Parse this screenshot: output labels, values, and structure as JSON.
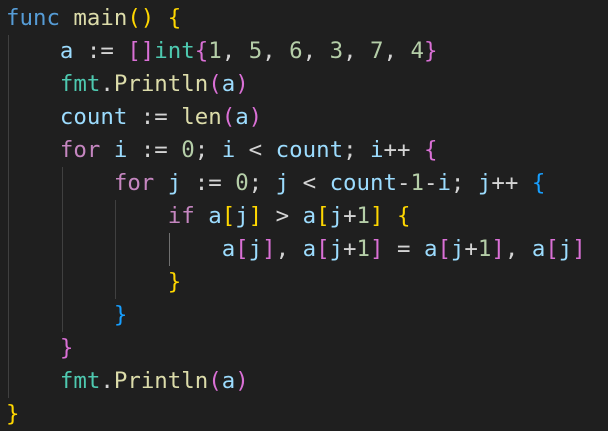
{
  "colors": {
    "background": "#1f1f1f",
    "default_text": "#d4d4d4",
    "keyword": "#569cd6",
    "control_keyword": "#c586c0",
    "function": "#dcdcaa",
    "variable": "#9cdcfe",
    "type": "#4ec9b0",
    "number": "#b5cea8",
    "bracket_level_1": "#ffd700",
    "bracket_level_2": "#da70d6",
    "bracket_level_3": "#179fff",
    "indent_guide": "#404040",
    "indent_guide_active": "#707070"
  },
  "code_lines": [
    [
      {
        "text": "func",
        "color": "#569cd6"
      },
      {
        "text": " ",
        "color": "#d4d4d4"
      },
      {
        "text": "main",
        "color": "#dcdcaa"
      },
      {
        "text": "()",
        "color": "#ffd700"
      },
      {
        "text": " ",
        "color": "#d4d4d4"
      },
      {
        "text": "{",
        "color": "#ffd700"
      }
    ],
    [
      {
        "text": "    ",
        "color": "#d4d4d4"
      },
      {
        "text": "a",
        "color": "#9cdcfe"
      },
      {
        "text": " := ",
        "color": "#d4d4d4"
      },
      {
        "text": "[]",
        "color": "#da70d6"
      },
      {
        "text": "int",
        "color": "#4ec9b0"
      },
      {
        "text": "{",
        "color": "#da70d6"
      },
      {
        "text": "1",
        "color": "#b5cea8"
      },
      {
        "text": ", ",
        "color": "#d4d4d4"
      },
      {
        "text": "5",
        "color": "#b5cea8"
      },
      {
        "text": ", ",
        "color": "#d4d4d4"
      },
      {
        "text": "6",
        "color": "#b5cea8"
      },
      {
        "text": ", ",
        "color": "#d4d4d4"
      },
      {
        "text": "3",
        "color": "#b5cea8"
      },
      {
        "text": ", ",
        "color": "#d4d4d4"
      },
      {
        "text": "7",
        "color": "#b5cea8"
      },
      {
        "text": ", ",
        "color": "#d4d4d4"
      },
      {
        "text": "4",
        "color": "#b5cea8"
      },
      {
        "text": "}",
        "color": "#da70d6"
      }
    ],
    [
      {
        "text": "    ",
        "color": "#d4d4d4"
      },
      {
        "text": "fmt",
        "color": "#4ec9b0"
      },
      {
        "text": ".",
        "color": "#d4d4d4"
      },
      {
        "text": "Println",
        "color": "#dcdcaa"
      },
      {
        "text": "(",
        "color": "#da70d6"
      },
      {
        "text": "a",
        "color": "#9cdcfe"
      },
      {
        "text": ")",
        "color": "#da70d6"
      }
    ],
    [
      {
        "text": "    ",
        "color": "#d4d4d4"
      },
      {
        "text": "count",
        "color": "#9cdcfe"
      },
      {
        "text": " := ",
        "color": "#d4d4d4"
      },
      {
        "text": "len",
        "color": "#dcdcaa"
      },
      {
        "text": "(",
        "color": "#da70d6"
      },
      {
        "text": "a",
        "color": "#9cdcfe"
      },
      {
        "text": ")",
        "color": "#da70d6"
      }
    ],
    [
      {
        "text": "    ",
        "color": "#d4d4d4"
      },
      {
        "text": "for",
        "color": "#c586c0"
      },
      {
        "text": " ",
        "color": "#d4d4d4"
      },
      {
        "text": "i",
        "color": "#9cdcfe"
      },
      {
        "text": " := ",
        "color": "#d4d4d4"
      },
      {
        "text": "0",
        "color": "#b5cea8"
      },
      {
        "text": "; ",
        "color": "#d4d4d4"
      },
      {
        "text": "i",
        "color": "#9cdcfe"
      },
      {
        "text": " < ",
        "color": "#d4d4d4"
      },
      {
        "text": "count",
        "color": "#9cdcfe"
      },
      {
        "text": "; ",
        "color": "#d4d4d4"
      },
      {
        "text": "i",
        "color": "#9cdcfe"
      },
      {
        "text": "++ ",
        "color": "#d4d4d4"
      },
      {
        "text": "{",
        "color": "#da70d6"
      }
    ],
    [
      {
        "text": "        ",
        "color": "#d4d4d4"
      },
      {
        "text": "for",
        "color": "#c586c0"
      },
      {
        "text": " ",
        "color": "#d4d4d4"
      },
      {
        "text": "j",
        "color": "#9cdcfe"
      },
      {
        "text": " := ",
        "color": "#d4d4d4"
      },
      {
        "text": "0",
        "color": "#b5cea8"
      },
      {
        "text": "; ",
        "color": "#d4d4d4"
      },
      {
        "text": "j",
        "color": "#9cdcfe"
      },
      {
        "text": " < ",
        "color": "#d4d4d4"
      },
      {
        "text": "count",
        "color": "#9cdcfe"
      },
      {
        "text": "-",
        "color": "#d4d4d4"
      },
      {
        "text": "1",
        "color": "#b5cea8"
      },
      {
        "text": "-",
        "color": "#d4d4d4"
      },
      {
        "text": "i",
        "color": "#9cdcfe"
      },
      {
        "text": "; ",
        "color": "#d4d4d4"
      },
      {
        "text": "j",
        "color": "#9cdcfe"
      },
      {
        "text": "++ ",
        "color": "#d4d4d4"
      },
      {
        "text": "{",
        "color": "#179fff"
      }
    ],
    [
      {
        "text": "            ",
        "color": "#d4d4d4"
      },
      {
        "text": "if",
        "color": "#c586c0"
      },
      {
        "text": " ",
        "color": "#d4d4d4"
      },
      {
        "text": "a",
        "color": "#9cdcfe"
      },
      {
        "text": "[",
        "color": "#ffd700"
      },
      {
        "text": "j",
        "color": "#9cdcfe"
      },
      {
        "text": "]",
        "color": "#ffd700"
      },
      {
        "text": " > ",
        "color": "#d4d4d4"
      },
      {
        "text": "a",
        "color": "#9cdcfe"
      },
      {
        "text": "[",
        "color": "#ffd700"
      },
      {
        "text": "j",
        "color": "#9cdcfe"
      },
      {
        "text": "+",
        "color": "#d4d4d4"
      },
      {
        "text": "1",
        "color": "#b5cea8"
      },
      {
        "text": "]",
        "color": "#ffd700"
      },
      {
        "text": " ",
        "color": "#d4d4d4"
      },
      {
        "text": "{",
        "color": "#ffd700"
      }
    ],
    [
      {
        "text": "                ",
        "color": "#d4d4d4"
      },
      {
        "text": "a",
        "color": "#9cdcfe"
      },
      {
        "text": "[",
        "color": "#da70d6"
      },
      {
        "text": "j",
        "color": "#9cdcfe"
      },
      {
        "text": "]",
        "color": "#da70d6"
      },
      {
        "text": ", ",
        "color": "#d4d4d4"
      },
      {
        "text": "a",
        "color": "#9cdcfe"
      },
      {
        "text": "[",
        "color": "#da70d6"
      },
      {
        "text": "j",
        "color": "#9cdcfe"
      },
      {
        "text": "+",
        "color": "#d4d4d4"
      },
      {
        "text": "1",
        "color": "#b5cea8"
      },
      {
        "text": "]",
        "color": "#da70d6"
      },
      {
        "text": " = ",
        "color": "#d4d4d4"
      },
      {
        "text": "a",
        "color": "#9cdcfe"
      },
      {
        "text": "[",
        "color": "#da70d6"
      },
      {
        "text": "j",
        "color": "#9cdcfe"
      },
      {
        "text": "+",
        "color": "#d4d4d4"
      },
      {
        "text": "1",
        "color": "#b5cea8"
      },
      {
        "text": "]",
        "color": "#da70d6"
      },
      {
        "text": ", ",
        "color": "#d4d4d4"
      },
      {
        "text": "a",
        "color": "#9cdcfe"
      },
      {
        "text": "[",
        "color": "#da70d6"
      },
      {
        "text": "j",
        "color": "#9cdcfe"
      },
      {
        "text": "]",
        "color": "#da70d6"
      }
    ],
    [
      {
        "text": "            ",
        "color": "#d4d4d4"
      },
      {
        "text": "}",
        "color": "#ffd700"
      }
    ],
    [
      {
        "text": "        ",
        "color": "#d4d4d4"
      },
      {
        "text": "}",
        "color": "#179fff"
      }
    ],
    [
      {
        "text": "    ",
        "color": "#d4d4d4"
      },
      {
        "text": "}",
        "color": "#da70d6"
      }
    ],
    [
      {
        "text": "    ",
        "color": "#d4d4d4"
      },
      {
        "text": "fmt",
        "color": "#4ec9b0"
      },
      {
        "text": ".",
        "color": "#d4d4d4"
      },
      {
        "text": "Println",
        "color": "#dcdcaa"
      },
      {
        "text": "(",
        "color": "#da70d6"
      },
      {
        "text": "a",
        "color": "#9cdcfe"
      },
      {
        "text": ")",
        "color": "#da70d6"
      }
    ],
    [
      {
        "text": "}",
        "color": "#ffd700"
      }
    ]
  ],
  "indent_guides": [
    {
      "level": 1,
      "from_line": 1,
      "to_line": 11,
      "active": false
    },
    {
      "level": 2,
      "from_line": 5,
      "to_line": 9,
      "active": false
    },
    {
      "level": 3,
      "from_line": 6,
      "to_line": 8,
      "active": false
    },
    {
      "level": 4,
      "from_line": 7,
      "to_line": 7,
      "active": true
    }
  ]
}
